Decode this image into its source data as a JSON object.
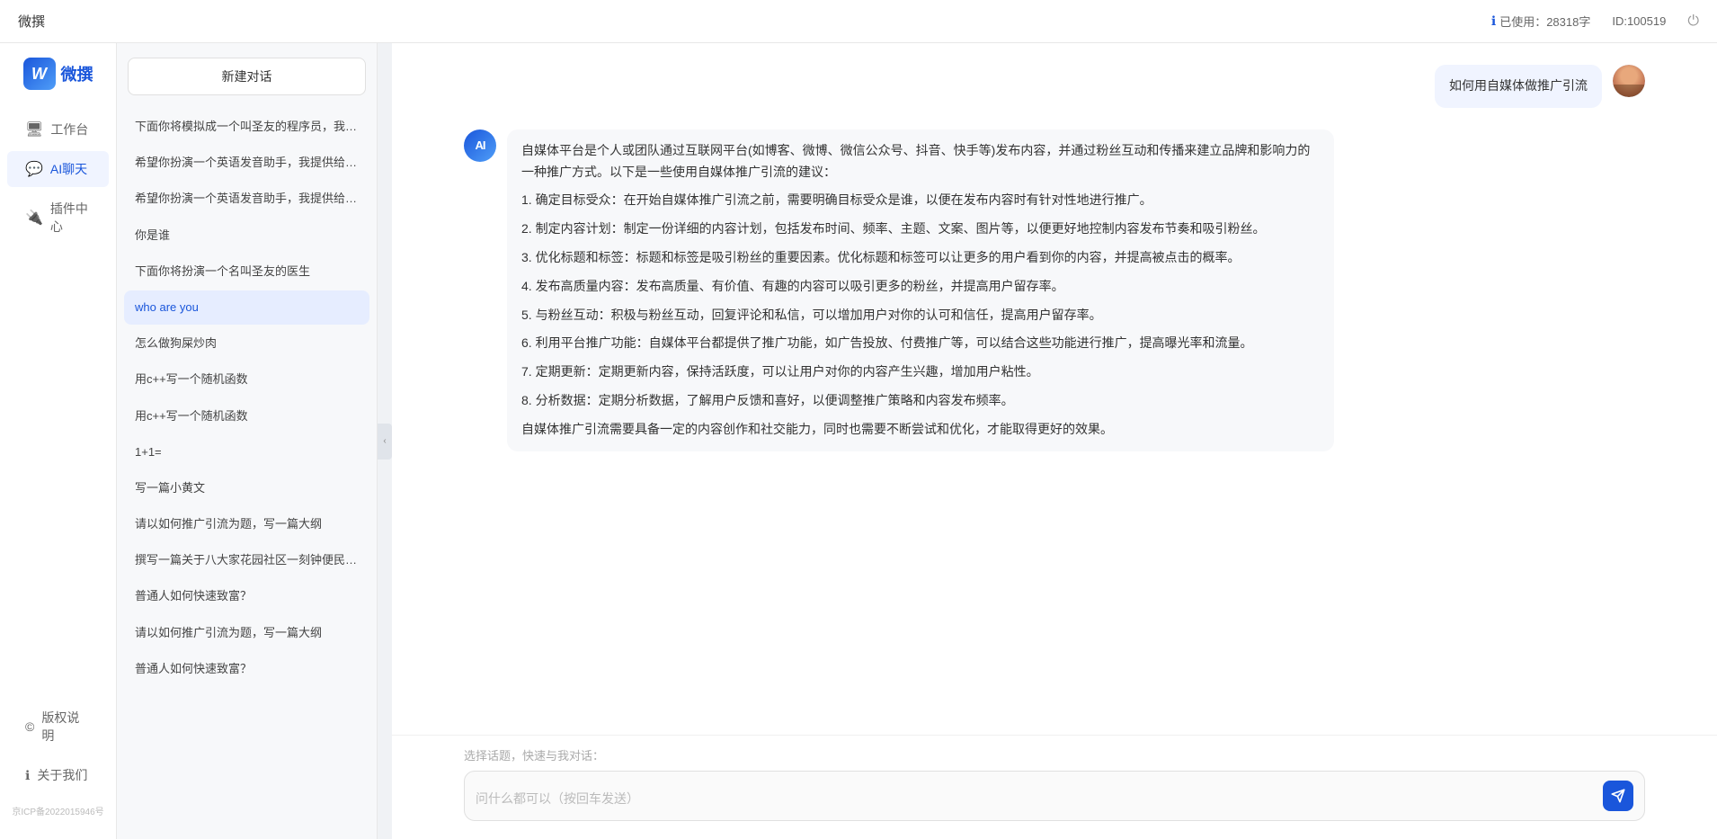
{
  "topbar": {
    "title": "微撰",
    "usage_label": "已使用：28318字",
    "id_label": "ID:100519",
    "usage_icon": "info-icon"
  },
  "logo": {
    "w": "W",
    "text": "微撰"
  },
  "nav": {
    "items": [
      {
        "id": "workbench",
        "label": "工作台",
        "icon": "🖥"
      },
      {
        "id": "ai-chat",
        "label": "AI聊天",
        "icon": "💬"
      },
      {
        "id": "plugins",
        "label": "插件中心",
        "icon": "🔌"
      }
    ],
    "bottom_items": [
      {
        "id": "copyright",
        "label": "版权说明",
        "icon": "©"
      },
      {
        "id": "about",
        "label": "关于我们",
        "icon": "ℹ"
      }
    ],
    "icp": "京ICP备2022015946号"
  },
  "chat_sidebar": {
    "new_btn": "新建对话",
    "items": [
      {
        "id": 1,
        "text": "下面你将模拟成一个叫圣友的程序员，我说...",
        "active": false
      },
      {
        "id": 2,
        "text": "希望你扮演一个英语发音助手，我提供给你...",
        "active": false
      },
      {
        "id": 3,
        "text": "希望你扮演一个英语发音助手，我提供给你...",
        "active": false
      },
      {
        "id": 4,
        "text": "你是谁",
        "active": false
      },
      {
        "id": 5,
        "text": "下面你将扮演一个名叫圣友的医生",
        "active": false
      },
      {
        "id": 6,
        "text": "who are you",
        "active": true
      },
      {
        "id": 7,
        "text": "怎么做狗屎炒肉",
        "active": false
      },
      {
        "id": 8,
        "text": "用c++写一个随机函数",
        "active": false
      },
      {
        "id": 9,
        "text": "用c++写一个随机函数",
        "active": false
      },
      {
        "id": 10,
        "text": "1+1=",
        "active": false
      },
      {
        "id": 11,
        "text": "写一篇小黄文",
        "active": false
      },
      {
        "id": 12,
        "text": "请以如何推广引流为题，写一篇大纲",
        "active": false
      },
      {
        "id": 13,
        "text": "撰写一篇关于八大家花园社区一刻钟便民生...",
        "active": false
      },
      {
        "id": 14,
        "text": "普通人如何快速致富？",
        "active": false
      },
      {
        "id": 15,
        "text": "请以如何推广引流为题，写一篇大纲",
        "active": false
      },
      {
        "id": 16,
        "text": "普通人如何快速致富？",
        "active": false
      }
    ]
  },
  "chat": {
    "messages": [
      {
        "role": "user",
        "text": "如何用自媒体做推广引流"
      },
      {
        "role": "ai",
        "paragraphs": [
          "自媒体平台是个人或团队通过互联网平台(如博客、微博、微信公众号、抖音、快手等)发布内容，并通过粉丝互动和传播来建立品牌和影响力的一种推广方式。以下是一些使用自媒体推广引流的建议：",
          "1. 确定目标受众：在开始自媒体推广引流之前，需要明确目标受众是谁，以便在发布内容时有针对性地进行推广。",
          "2. 制定内容计划：制定一份详细的内容计划，包括发布时间、频率、主题、文案、图片等，以便更好地控制内容发布节奏和吸引粉丝。",
          "3. 优化标题和标签：标题和标签是吸引粉丝的重要因素。优化标题和标签可以让更多的用户看到你的内容，并提高被点击的概率。",
          "4. 发布高质量内容：发布高质量、有价值、有趣的内容可以吸引更多的粉丝，并提高用户留存率。",
          "5. 与粉丝互动：积极与粉丝互动，回复评论和私信，可以增加用户对你的认可和信任，提高用户留存率。",
          "6. 利用平台推广功能：自媒体平台都提供了推广功能，如广告投放、付费推广等，可以结合这些功能进行推广，提高曝光率和流量。",
          "7. 定期更新：定期更新内容，保持活跃度，可以让用户对你的内容产生兴趣，增加用户粘性。",
          "8. 分析数据：定期分析数据，了解用户反馈和喜好，以便调整推广策略和内容发布频率。",
          "自媒体推广引流需要具备一定的内容创作和社交能力，同时也需要不断尝试和优化，才能取得更好的效果。"
        ]
      }
    ],
    "input_placeholder": "问什么都可以（按回车发送）",
    "quick_topic_label": "选择话题，快速与我对话："
  }
}
